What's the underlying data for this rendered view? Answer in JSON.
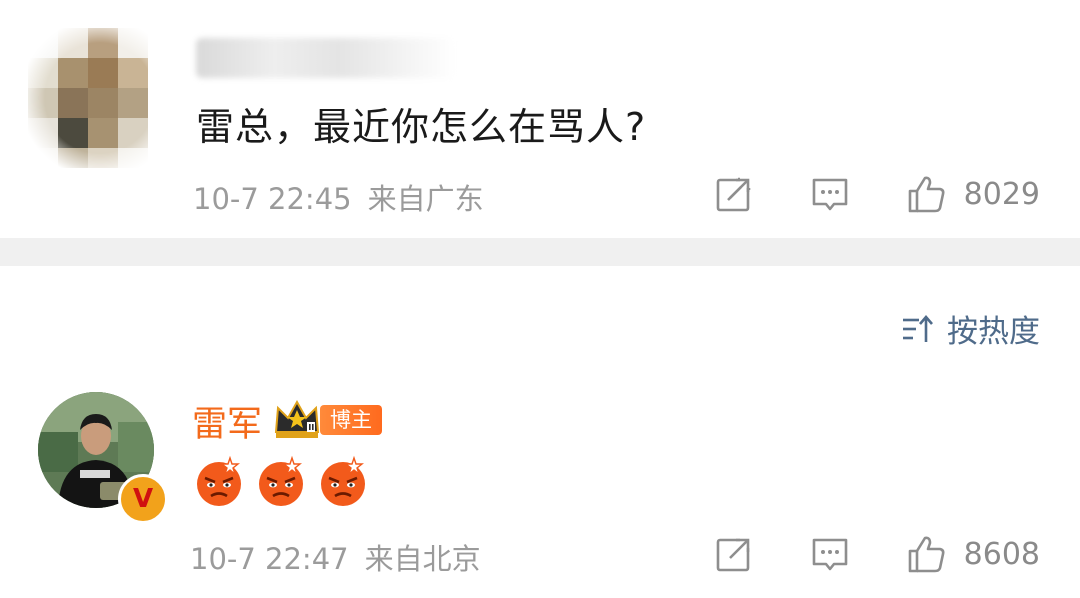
{
  "post": {
    "comment_text": "雷总，最近你怎么在骂人?",
    "date": "10-7 22:45",
    "location": "来自广东",
    "likes": "8029",
    "share_icon": "share-icon",
    "comment_icon": "comment-icon",
    "like_icon": "thumbs-up-icon"
  },
  "sort": {
    "label": "按热度",
    "icon": "sort-icon"
  },
  "reply": {
    "author_name": "雷军",
    "badge_label": "博主",
    "verified_mark": "V",
    "emojis": [
      "angry-face",
      "angry-face",
      "angry-face"
    ],
    "date": "10-7 22:47",
    "location": "来自北京",
    "likes": "8608"
  },
  "colors": {
    "author_name": "#f36a1b",
    "badge_bg": "#ff7a2a",
    "sort_label": "#4f6b8a",
    "meta_text": "#9b9b9b",
    "divider": "#f0f0f0"
  }
}
